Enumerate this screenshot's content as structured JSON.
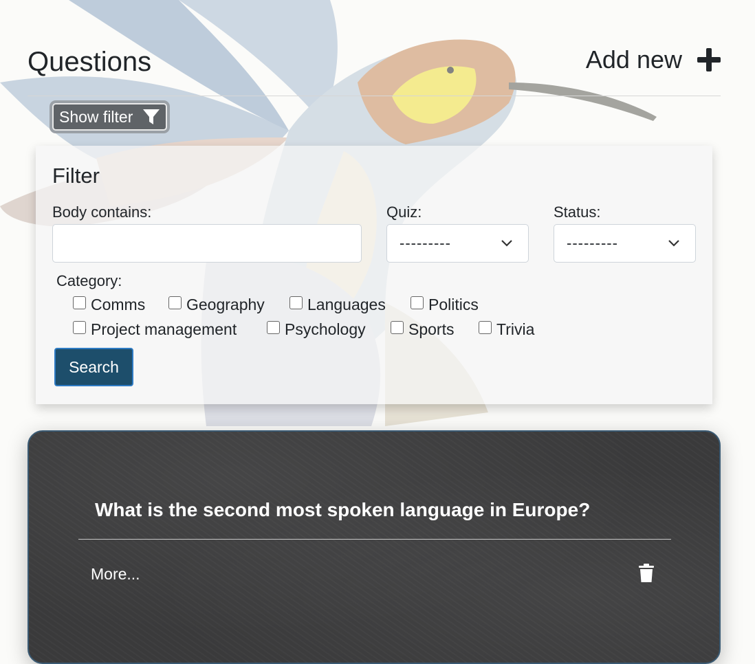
{
  "header": {
    "title": "Questions",
    "add_new_label": "Add new",
    "add_icon": "plus-icon"
  },
  "show_filter": {
    "label": "Show filter",
    "icon": "filter-icon"
  },
  "filter": {
    "title": "Filter",
    "body_label": "Body contains:",
    "body_value": "",
    "quiz_label": "Quiz:",
    "quiz_selected": "---------",
    "status_label": "Status:",
    "status_selected": "---------",
    "category_label": "Category:",
    "categories": [
      {
        "label": "Comms",
        "checked": false
      },
      {
        "label": "Geography",
        "checked": false
      },
      {
        "label": "Languages",
        "checked": false
      },
      {
        "label": "Politics",
        "checked": false
      },
      {
        "label": "Project management",
        "checked": false
      },
      {
        "label": "Psychology",
        "checked": false
      },
      {
        "label": "Sports",
        "checked": false
      },
      {
        "label": "Trivia",
        "checked": false
      }
    ],
    "search_label": "Search"
  },
  "question_card": {
    "question": "What is the second most spoken language in Europe?",
    "more_label": "More...",
    "delete_icon": "trash-icon"
  },
  "colors": {
    "accent_button": "#1d4e6b",
    "card_background": "#3a3a3b",
    "filter_button": "#5f6367"
  }
}
